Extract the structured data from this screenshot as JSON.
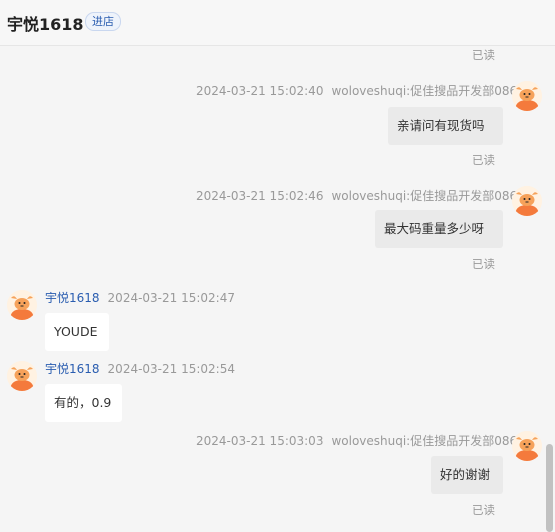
{
  "header": {
    "shop_name": "宇悦1618",
    "enter_store_label": "进店"
  },
  "read_label": "已读",
  "messages": [
    {
      "direction": "outgoing",
      "timestamp": "2024-03-21 15:02:40",
      "sender": "woloveshuqi:促佳搜品开发部086",
      "text": "亲请问有现货吗",
      "status": "已读"
    },
    {
      "direction": "outgoing",
      "timestamp": "2024-03-21 15:02:46",
      "sender": "woloveshuqi:促佳搜品开发部086",
      "text": "最大码重量多少呀",
      "status": "已读"
    },
    {
      "direction": "incoming",
      "timestamp": "2024-03-21 15:02:47",
      "sender": "宇悦1618",
      "text": "YOUDE"
    },
    {
      "direction": "incoming",
      "timestamp": "2024-03-21 15:02:54",
      "sender": "宇悦1618",
      "text": "有的，0.9"
    },
    {
      "direction": "outgoing",
      "timestamp": "2024-03-21 15:03:03",
      "sender": "woloveshuqi:促佳搜品开发部086",
      "text": "好的谢谢",
      "status": "已读"
    }
  ],
  "colors": {
    "background": "#f5f5f5",
    "self_bubble": "#eaeaea",
    "other_bubble": "#ffffff",
    "sender_link": "#2a5db0",
    "meta_text": "#999999",
    "avatar_orange": "#f47a3c"
  },
  "icons": {
    "avatar": "cartoon-cat-avatar-icon"
  }
}
